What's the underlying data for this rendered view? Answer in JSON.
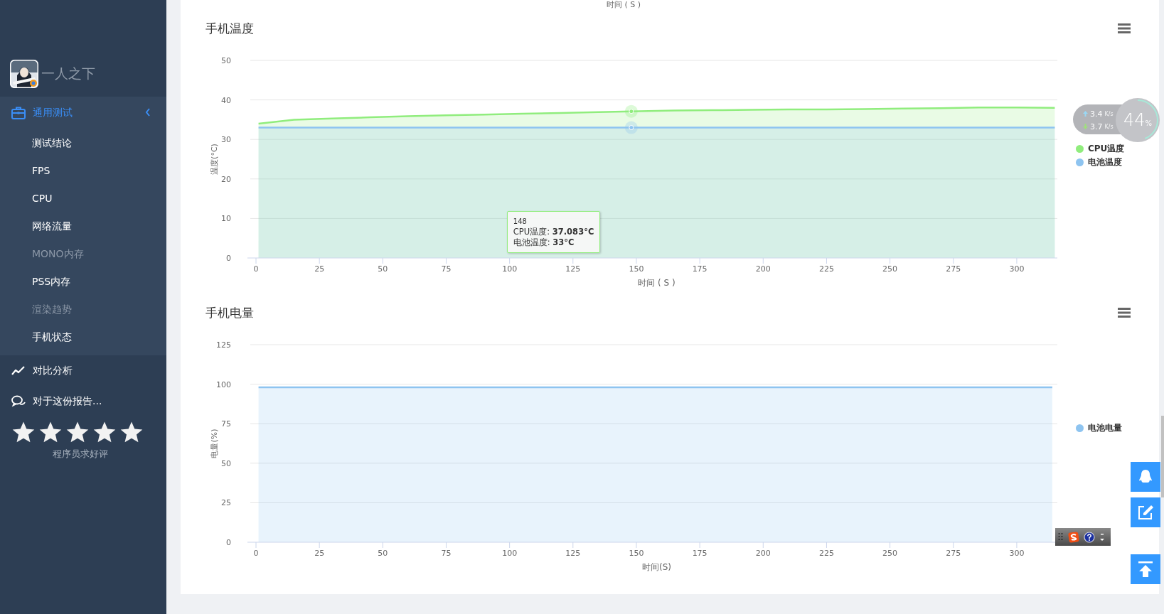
{
  "app": {
    "name": "一人之下"
  },
  "sidebar": {
    "items": [
      {
        "kind": "menu",
        "label": "通用测试",
        "selected": true,
        "expanded": true,
        "children": [
          {
            "label": "测试结论",
            "disabled": false
          },
          {
            "label": "FPS",
            "disabled": false
          },
          {
            "label": "CPU",
            "disabled": false
          },
          {
            "label": "网络流量",
            "disabled": false
          },
          {
            "label": "MONO内存",
            "disabled": true
          },
          {
            "label": "PSS内存",
            "disabled": false
          },
          {
            "label": "渲染趋势",
            "disabled": true
          },
          {
            "label": "手机状态",
            "disabled": false
          }
        ]
      },
      {
        "kind": "link",
        "label": "对比分析",
        "selected": false
      },
      {
        "kind": "link",
        "label": "对于这份报告...",
        "selected": false
      }
    ]
  },
  "rating": {
    "stars": 5,
    "caption": "程序员求好评"
  },
  "top_axis_label": "时间 ( S )",
  "charts": [
    {
      "title": "手机温度",
      "chart_data": {
        "type": "area",
        "xlabel": "时间 ( S )",
        "ylabel": "温度(°C)",
        "x": [
          1,
          15,
          30,
          45,
          60,
          75,
          90,
          105,
          120,
          135,
          148,
          165,
          180,
          195,
          210,
          225,
          240,
          255,
          270,
          285,
          300,
          315
        ],
        "series": [
          {
            "name": "CPU温度",
            "color": "#90ed7d",
            "values": [
              34,
              35,
              35.3,
              35.6,
              35.9,
              36.1,
              36.3,
              36.5,
              36.7,
              36.9,
              37.1,
              37.3,
              37.4,
              37.5,
              37.6,
              37.6,
              37.7,
              37.8,
              37.9,
              38.1,
              38.1,
              38
            ]
          },
          {
            "name": "电池温度",
            "color": "#8ec4f0",
            "values": [
              33,
              33,
              33,
              33,
              33,
              33,
              33,
              33,
              33,
              33,
              33,
              33,
              33,
              33,
              33,
              33,
              33,
              33,
              33,
              33,
              33,
              33
            ]
          }
        ],
        "grid": true,
        "xlim": [
          0,
          316
        ],
        "ylim": [
          0,
          50
        ],
        "xticks": [
          0,
          25,
          50,
          75,
          100,
          125,
          150,
          175,
          200,
          225,
          250,
          275,
          300
        ],
        "yticks": [
          0,
          10,
          20,
          30,
          40,
          50
        ]
      },
      "tooltip": {
        "title": "148",
        "lines": [
          "CPU温度: **37.083°C**",
          "电池温度: **33°C**"
        ]
      }
    },
    {
      "title": "手机电量",
      "chart_data": {
        "type": "area",
        "xlabel": "时间(S)",
        "ylabel": "电量(%)",
        "x": [
          1,
          15,
          30,
          45,
          60,
          75,
          90,
          105,
          120,
          135,
          150,
          165,
          180,
          195,
          210,
          225,
          240,
          255,
          270,
          285,
          300,
          314
        ],
        "series": [
          {
            "name": "电池电量",
            "color": "#8ec4f0",
            "values": [
              98,
              98,
              98,
              98,
              98,
              98,
              98,
              98,
              98,
              98,
              98,
              98,
              98,
              98,
              98,
              98,
              98,
              98,
              98,
              98,
              98,
              98
            ]
          }
        ],
        "grid": true,
        "xlim": [
          0,
          316
        ],
        "ylim": [
          0,
          125
        ],
        "xticks": [
          0,
          25,
          50,
          75,
          100,
          125,
          150,
          175,
          200,
          225,
          250,
          275,
          300
        ],
        "yticks": [
          0,
          25,
          50,
          75,
          100,
          125
        ]
      }
    }
  ],
  "network_monitor": {
    "upload": "3.4",
    "download": "3.7",
    "upload_unit": "K/s",
    "download_unit": "K/s",
    "usage": "44",
    "usage_unit": "%",
    "level": 0.44
  }
}
